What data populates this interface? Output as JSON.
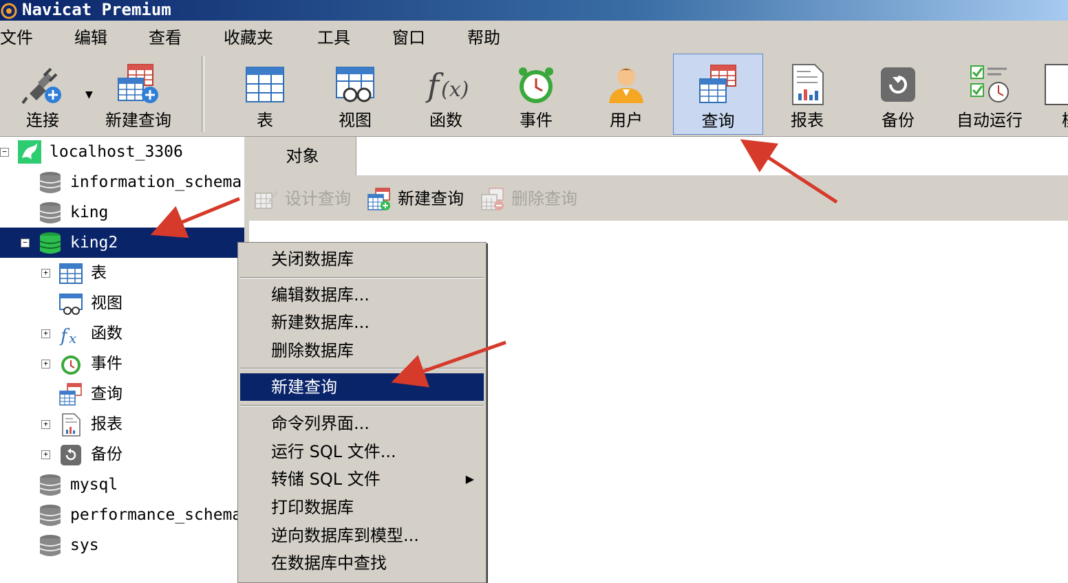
{
  "app": {
    "title": "Navicat Premium"
  },
  "menubar": [
    "文件",
    "编辑",
    "查看",
    "收藏夹",
    "工具",
    "窗口",
    "帮助"
  ],
  "toolbar": {
    "connect": "连接",
    "new_query": "新建查询",
    "table": "表",
    "view": "视图",
    "function": "函数",
    "event": "事件",
    "user": "用户",
    "query": "查询",
    "report": "报表",
    "backup": "备份",
    "schedule": "自动运行",
    "model_partial": "模"
  },
  "tree": {
    "connection": "localhost_3306",
    "databases": [
      "information_schema",
      "king",
      "king2",
      "mysql",
      "performance_schema",
      "sys"
    ],
    "king2_children": [
      "表",
      "视图",
      "函数",
      "事件",
      "查询",
      "报表",
      "备份"
    ]
  },
  "right_pane": {
    "tab": "对象",
    "design_query": "设计查询",
    "new_query": "新建查询",
    "delete_query": "删除查询"
  },
  "context_menu": {
    "items": [
      "关闭数据库",
      "编辑数据库...",
      "新建数据库...",
      "删除数据库",
      "新建查询",
      "命令列界面...",
      "运行 SQL 文件...",
      "转储 SQL 文件",
      "打印数据库",
      "逆向数据库到模型...",
      "在数据库中查找"
    ]
  },
  "colors": {
    "selection": "#0a246a",
    "annotation_arrow": "#d63a2b",
    "active_toolbar": "#c9d8f0"
  }
}
